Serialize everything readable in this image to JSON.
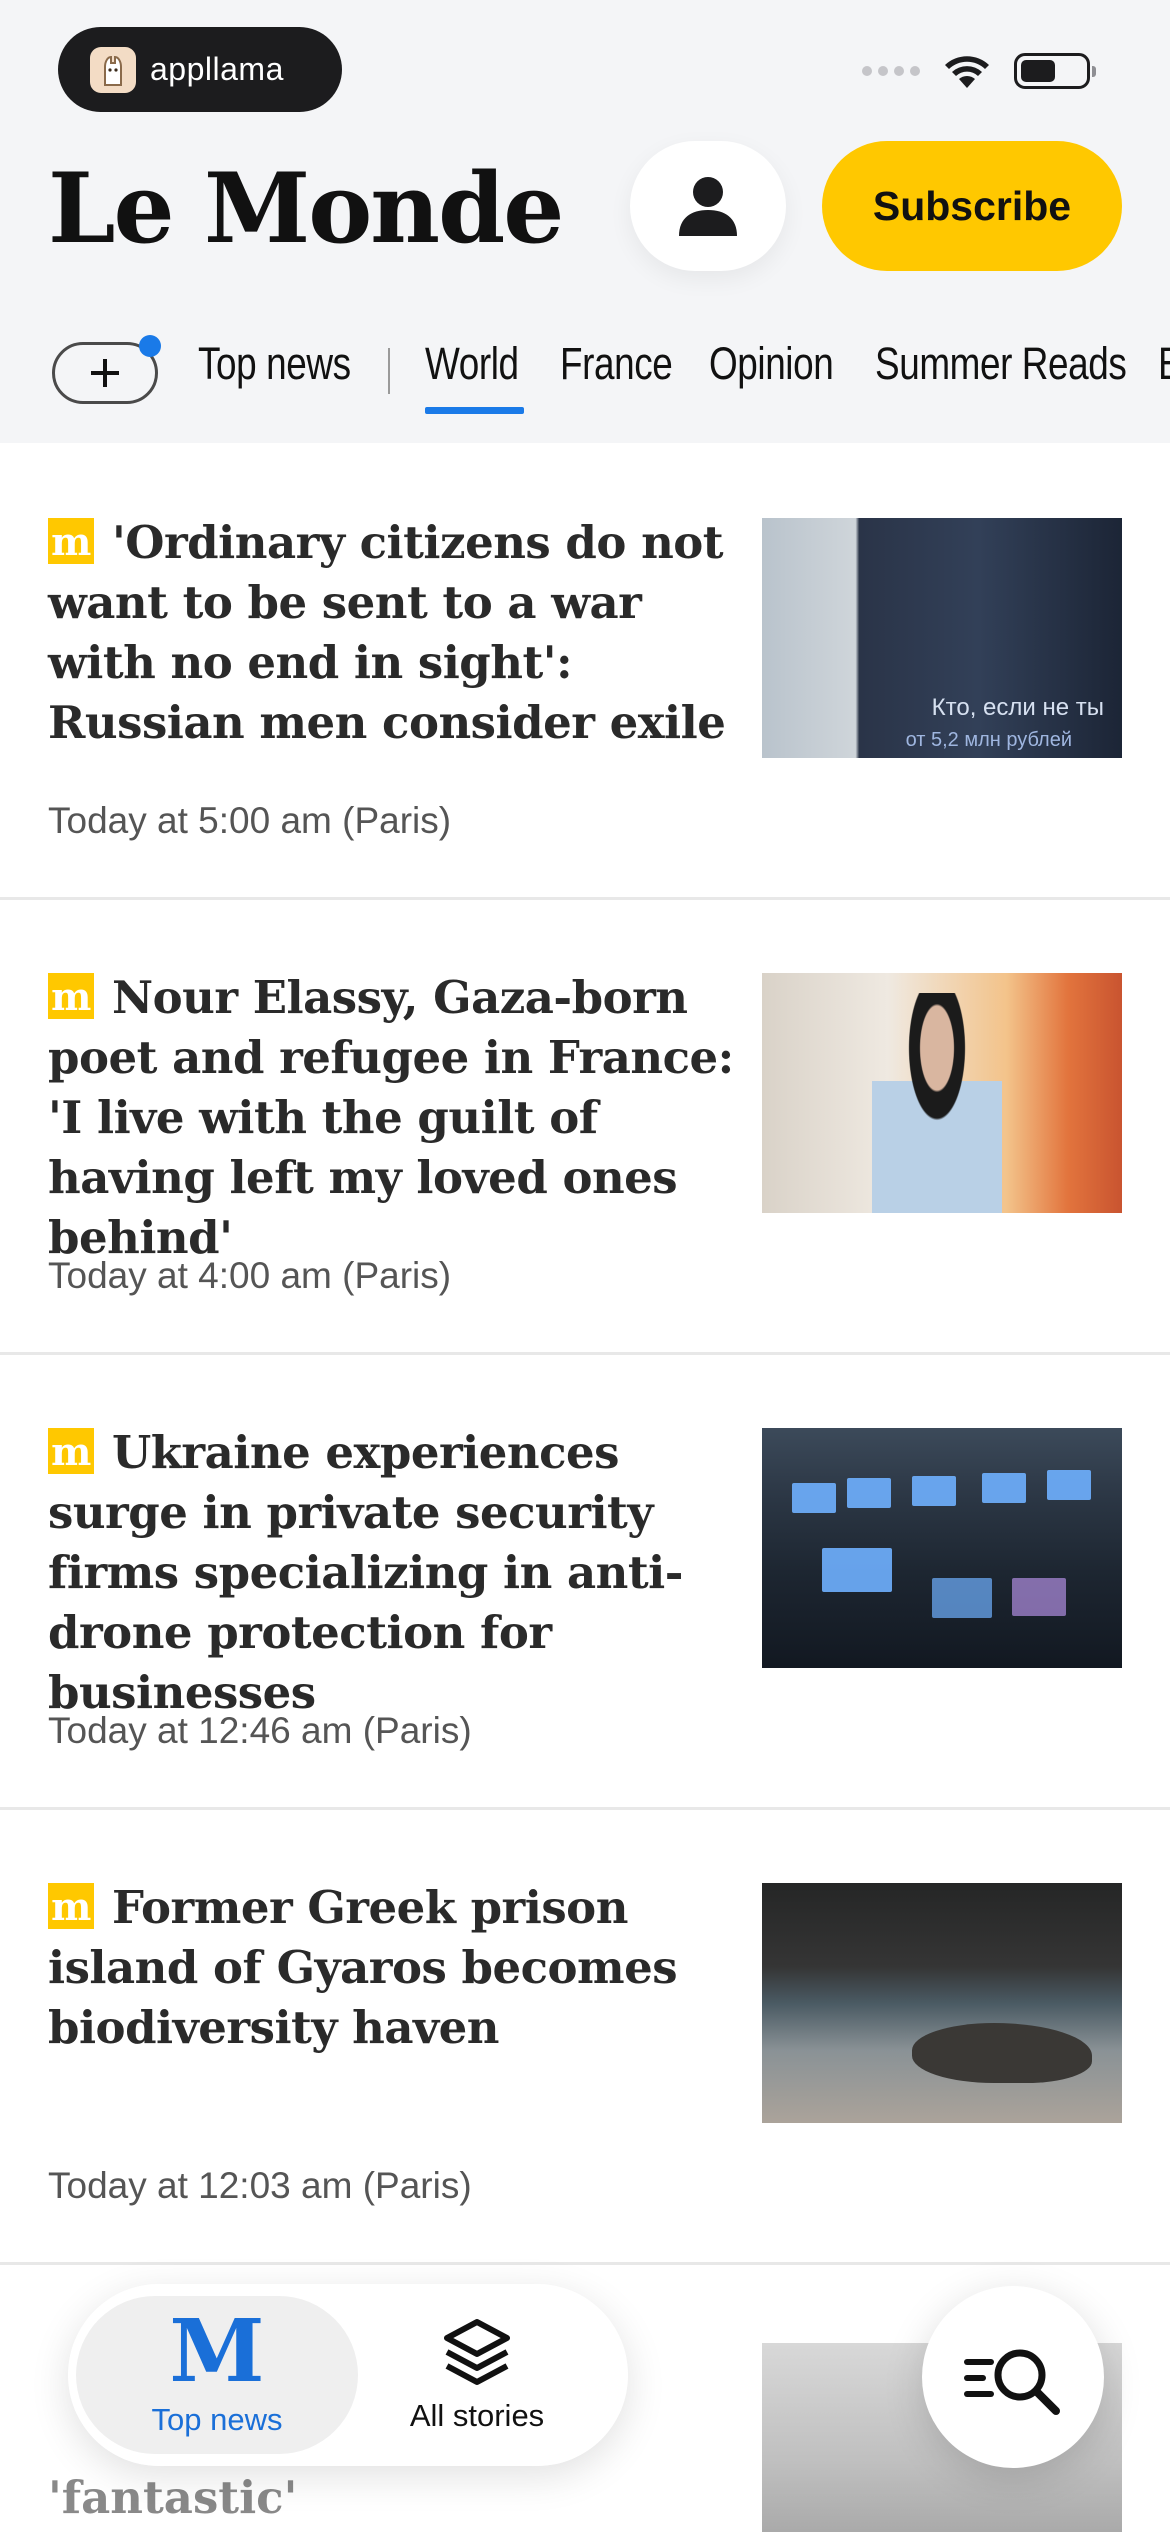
{
  "status_bar": {
    "app_badge": "appllama"
  },
  "header": {
    "logo_text": "Le Monde",
    "subscribe_label": "Subscribe"
  },
  "nav": {
    "tabs": [
      "Top news",
      "World",
      "France",
      "Opinion",
      "Summer Reads",
      "B"
    ],
    "active_tab": "World"
  },
  "articles": [
    {
      "title": "'Ordinary citizens do not want to be sent to a war with no end in sight': Russian men consider exile",
      "time": "Today at 5:00 am (Paris)",
      "image_caption_1": "Кто, если не ты",
      "image_caption_2": "от 5,2 млн рублей"
    },
    {
      "title": "Nour Elassy, Gaza-born poet and refugee in France: 'I live with the guilt of having left my loved ones behind'",
      "time": "Today at 4:00 am (Paris)"
    },
    {
      "title": "Ukraine experiences surge in private security firms specializing in anti-drone protection for businesses",
      "time": "Today at 12:46 am (Paris)"
    },
    {
      "title": "Former Greek prison island of Gyaros becomes biodiversity haven",
      "time": "Today at 12:03 am (Paris)"
    },
    {
      "title": "'fantastic'"
    }
  ],
  "tabbar": {
    "top_news_label": "Top news",
    "all_stories_label": "All stories"
  },
  "colors": {
    "accent_blue": "#1a7ae8",
    "subscribe_yellow": "#ffc800",
    "header_bg": "#f4f5f7"
  }
}
